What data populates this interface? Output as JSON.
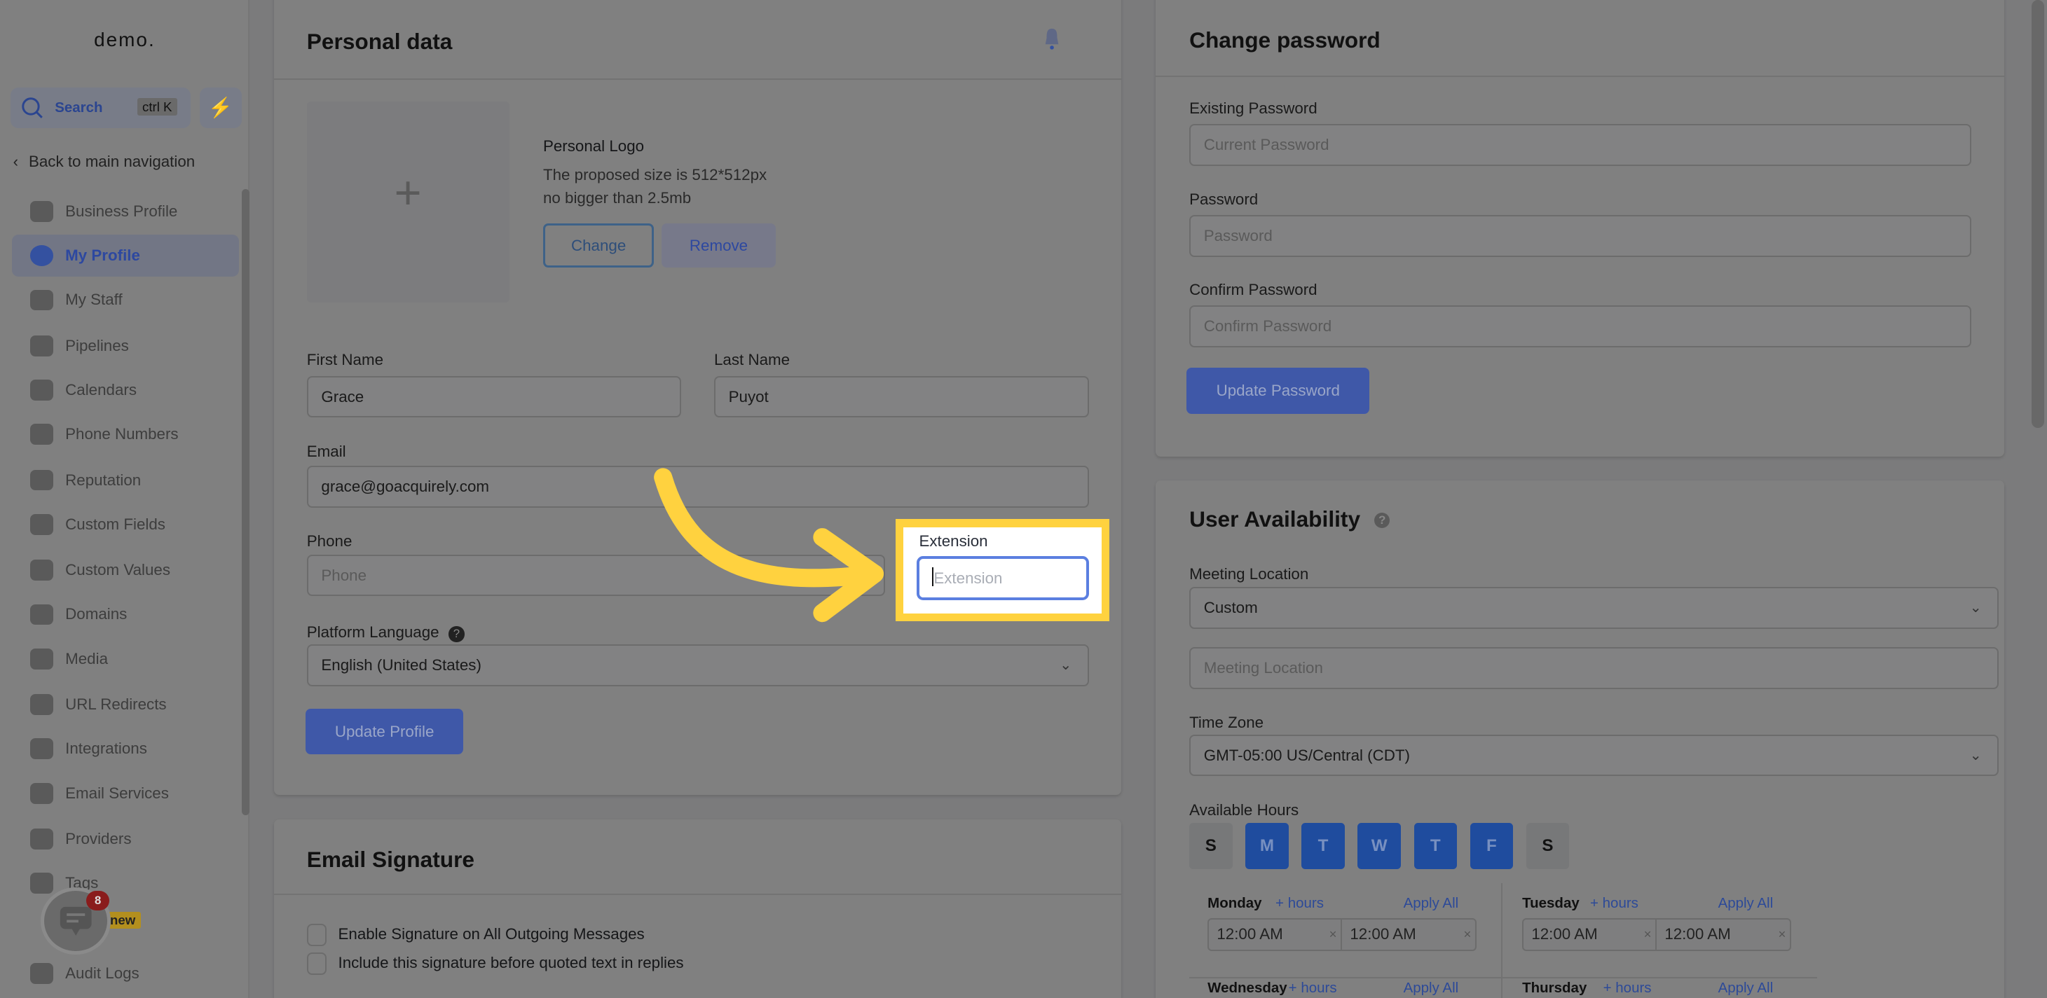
{
  "sidebar": {
    "logo": "demo.",
    "search_label": "Search",
    "search_shortcut": "ctrl K",
    "back_label": "Back to main navigation",
    "items": [
      {
        "label": "Business Profile",
        "icon": "briefcase-icon"
      },
      {
        "label": "My Profile",
        "icon": "user-circle-icon",
        "active": true
      },
      {
        "label": "My Staff",
        "icon": "user-icon"
      },
      {
        "label": "Pipelines",
        "icon": "filter-icon"
      },
      {
        "label": "Calendars",
        "icon": "calendar-icon"
      },
      {
        "label": "Phone Numbers",
        "icon": "phone-icon"
      },
      {
        "label": "Reputation",
        "icon": "star-icon"
      },
      {
        "label": "Custom Fields",
        "icon": "fields-icon"
      },
      {
        "label": "Custom Values",
        "icon": "gem-icon"
      },
      {
        "label": "Domains",
        "icon": "globe-icon"
      },
      {
        "label": "Media",
        "icon": "media-icon"
      },
      {
        "label": "URL Redirects",
        "icon": "redirect-icon"
      },
      {
        "label": "Integrations",
        "icon": "integrations-icon"
      },
      {
        "label": "Email Services",
        "icon": "mail-icon"
      },
      {
        "label": "Providers",
        "icon": "clipboard-icon"
      },
      {
        "label": "Tags",
        "icon": "tag-icon"
      },
      {
        "label": "Audit Logs",
        "icon": "chart-icon"
      }
    ],
    "new_badge": "new",
    "chat_badge_count": "8"
  },
  "personal": {
    "title": "Personal data",
    "logo_title": "Personal Logo",
    "logo_hint_1": "The proposed size is 512*512px",
    "logo_hint_2": "no bigger than 2.5mb",
    "change_label": "Change",
    "remove_label": "Remove",
    "first_name_label": "First Name",
    "first_name": "Grace",
    "last_name_label": "Last Name",
    "last_name": "Puyot",
    "email_label": "Email",
    "email": "grace@goacquirely.com",
    "phone_label": "Phone",
    "phone_placeholder": "Phone",
    "extension_label": "Extension",
    "extension_placeholder": "Extension",
    "language_label": "Platform Language",
    "language": "English (United States)",
    "update_label": "Update Profile"
  },
  "signature": {
    "title": "Email Signature",
    "option_1": "Enable Signature on All Outgoing Messages",
    "option_2": "Include this signature before quoted text in replies"
  },
  "password": {
    "title": "Change password",
    "existing_label": "Existing Password",
    "existing_placeholder": "Current Password",
    "password_label": "Password",
    "password_placeholder": "Password",
    "confirm_label": "Confirm Password",
    "confirm_placeholder": "Confirm Password",
    "update_label": "Update Password"
  },
  "availability": {
    "title": "User Availability",
    "meeting_location_label": "Meeting Location",
    "meeting_location": "Custom",
    "meeting_location_placeholder": "Meeting Location",
    "timezone_label": "Time Zone",
    "timezone": "GMT-05:00 US/Central (CDT)",
    "hours_label": "Available Hours",
    "days": [
      {
        "letter": "S",
        "on": false
      },
      {
        "letter": "M",
        "on": true
      },
      {
        "letter": "T",
        "on": true
      },
      {
        "letter": "W",
        "on": true
      },
      {
        "letter": "T",
        "on": true
      },
      {
        "letter": "F",
        "on": true
      },
      {
        "letter": "S",
        "on": false
      }
    ],
    "add_hours": "+ hours",
    "apply_all": "Apply All",
    "schedule": [
      {
        "day": "Monday",
        "start": "12:00 AM",
        "end": "12:00 AM"
      },
      {
        "day": "Tuesday",
        "start": "12:00 AM",
        "end": "12:00 AM"
      },
      {
        "day": "Wednesday"
      },
      {
        "day": "Thursday"
      }
    ]
  },
  "highlight_color": "#FFD23F",
  "focus_color": "#5B7FE0"
}
